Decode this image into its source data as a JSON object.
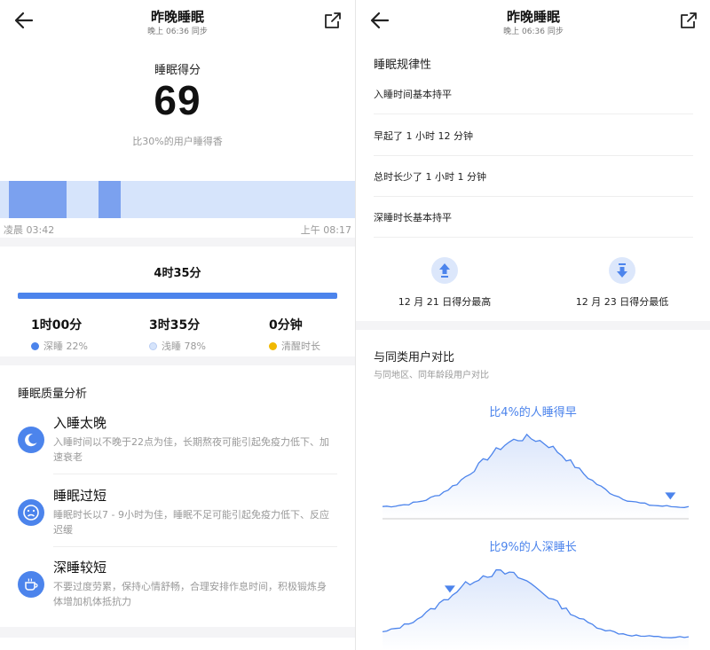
{
  "colors": {
    "accent": "#4c84ec",
    "deep": "#4c84ec",
    "light": "#d6e4fb",
    "awake": "#f0b800",
    "muted": "#999999"
  },
  "left": {
    "header": {
      "title": "昨晚睡眠",
      "sync": "晚上 06:36 同步"
    },
    "score": {
      "label": "睡眠得分",
      "value": "69",
      "compare": "比30%的用户睡得香"
    },
    "timeline": {
      "start": "凌晨 03:42",
      "end": "上午 08:17",
      "deep_segments": [
        [
          0.025,
          0.187
        ],
        [
          0.277,
          0.34
        ]
      ]
    },
    "total": {
      "label": "4时35分",
      "fill_fraction": 1.0
    },
    "stats": [
      {
        "value": "1时00分",
        "label": "深睡 22%",
        "color": "#4c84ec"
      },
      {
        "value": "3时35分",
        "label": "浅睡 78%",
        "color": "#d6e4fb"
      },
      {
        "value": "0分钟",
        "label": "清醒时长",
        "color": "#f0b800"
      }
    ],
    "analysis": {
      "title": "睡眠质量分析",
      "items": [
        {
          "icon": "moon-icon",
          "title": "入睡太晚",
          "desc": "入睡时间以不晚于22点为佳，长期熬夜可能引起免疫力低下、加速衰老"
        },
        {
          "icon": "sad-face-icon",
          "title": "睡眠过短",
          "desc": "睡眠时长以7 - 9小时为佳，睡眠不足可能引起免疫力低下、反应迟缓"
        },
        {
          "icon": "coffee-cup-icon",
          "title": "深睡较短",
          "desc": "不要过度劳累，保持心情舒畅，合理安排作息时间，积极锻炼身体增加机体抵抗力"
        }
      ]
    }
  },
  "right": {
    "header": {
      "title": "昨晚睡眠",
      "sync": "晚上 06:36 同步"
    },
    "regularity": {
      "title": "睡眠规律性",
      "rows": [
        "入睡时间基本持平",
        "早起了 1 小时 12 分钟",
        "总时长少了 1 小时 1 分钟",
        "深睡时长基本持平"
      ]
    },
    "best_worst": [
      {
        "icon": "arrow-up-icon",
        "label": "12 月 21 日得分最高"
      },
      {
        "icon": "arrow-down-icon",
        "label": "12 月 23 日得分最低"
      }
    ],
    "compare": {
      "title": "与同类用户对比",
      "subtitle": "与同地区、同年龄段用户对比",
      "charts": [
        {
          "label": "比4%的人睡得早",
          "marker_fraction": 0.94
        },
        {
          "label": "比9%的人深睡长",
          "marker_fraction": 0.22
        }
      ]
    }
  }
}
